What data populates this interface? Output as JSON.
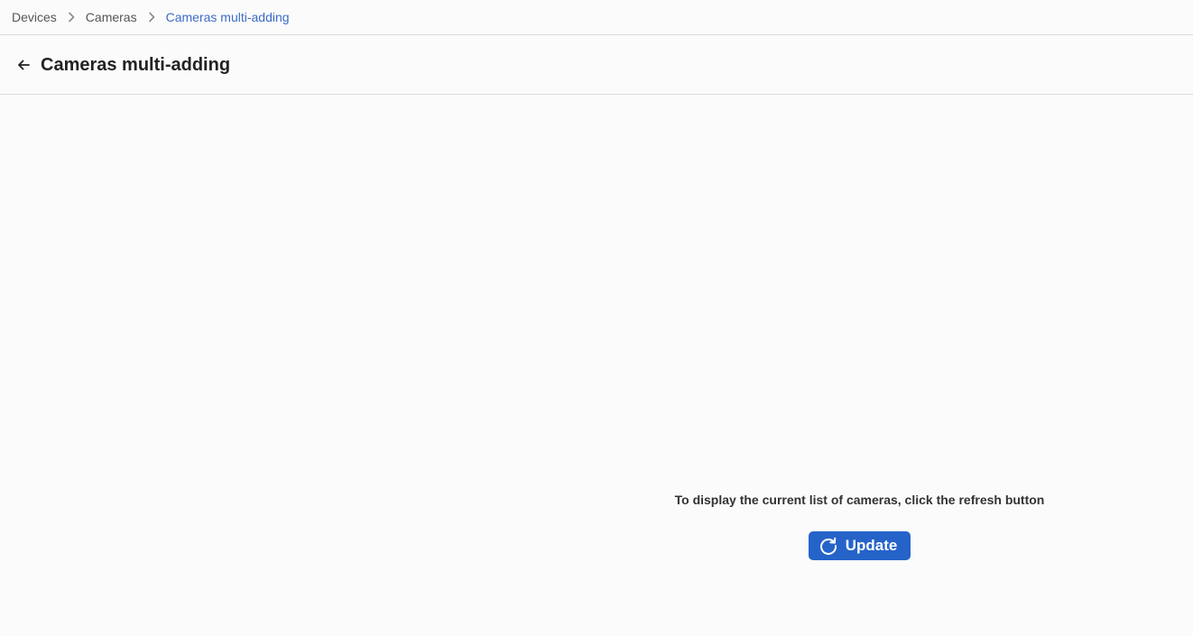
{
  "breadcrumb": {
    "items": [
      {
        "label": "Devices"
      },
      {
        "label": "Cameras"
      },
      {
        "label": "Cameras multi-adding"
      }
    ],
    "separator_icon": "chevron-right-icon"
  },
  "header": {
    "back_icon": "arrow-left-icon",
    "title": "Cameras multi-adding"
  },
  "empty_state": {
    "message": "To display the current list of cameras, click the refresh button",
    "update_button": {
      "label": "Update",
      "icon": "refresh-icon"
    }
  },
  "colors": {
    "accent": "#2563c9",
    "breadcrumb_current": "#3d6bc9",
    "background": "#fbfbfb",
    "divider": "#dcdcdc"
  }
}
